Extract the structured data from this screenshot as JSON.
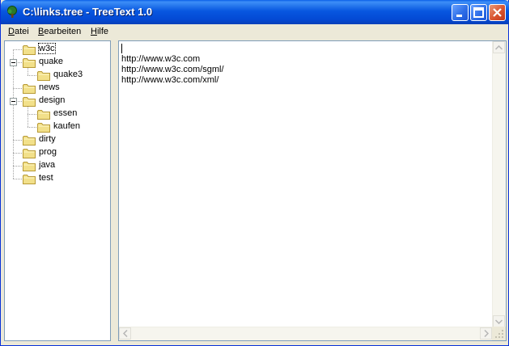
{
  "window": {
    "title": "C:\\links.tree - TreeText 1.0",
    "icon": "tree-icon"
  },
  "menu": [
    {
      "label": "Datei",
      "mnemonic": "D",
      "rest": "atei"
    },
    {
      "label": "Bearbeiten",
      "mnemonic": "B",
      "rest": "earbeiten"
    },
    {
      "label": "Hilfe",
      "mnemonic": "H",
      "rest": "ilfe"
    }
  ],
  "tree": {
    "nodes": [
      {
        "label": "w3c",
        "level": 0,
        "expanded": null,
        "selected": true
      },
      {
        "label": "quake",
        "level": 0,
        "expanded": true
      },
      {
        "label": "quake3",
        "level": 1
      },
      {
        "label": "news",
        "level": 0
      },
      {
        "label": "design",
        "level": 0,
        "expanded": true
      },
      {
        "label": "essen",
        "level": 1
      },
      {
        "label": "kaufen",
        "level": 1
      },
      {
        "label": "dirty",
        "level": 0
      },
      {
        "label": "prog",
        "level": 0
      },
      {
        "label": "java",
        "level": 0
      },
      {
        "label": "test",
        "level": 0
      }
    ]
  },
  "editor": {
    "lines": [
      "",
      "http://www.w3c.com",
      "http://www.w3c.com/sgml/",
      "http://www.w3c.com/xml/"
    ]
  },
  "colors": {
    "titlebar": "#0857e0",
    "folder": "#f2e08a",
    "folder_border": "#b89a36"
  }
}
